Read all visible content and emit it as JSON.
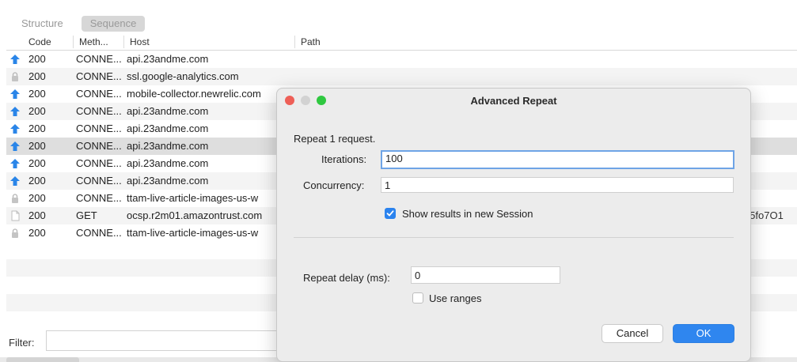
{
  "tabs": {
    "structure": "Structure",
    "sequence": "Sequence"
  },
  "table": {
    "headers": {
      "code": "Code",
      "method": "Meth...",
      "host": "Host",
      "path": "Path"
    },
    "rows": [
      {
        "code": "200",
        "method": "CONNE...",
        "host": "api.23andme.com",
        "path": "",
        "icon": "upload-arrow-icon"
      },
      {
        "code": "200",
        "method": "CONNE...",
        "host": "ssl.google-analytics.com",
        "path": "",
        "icon": "lock-icon"
      },
      {
        "code": "200",
        "method": "CONNE...",
        "host": "mobile-collector.newrelic.com",
        "path": "",
        "icon": "upload-arrow-icon"
      },
      {
        "code": "200",
        "method": "CONNE...",
        "host": "api.23andme.com",
        "path": "",
        "icon": "upload-arrow-icon"
      },
      {
        "code": "200",
        "method": "CONNE...",
        "host": "api.23andme.com",
        "path": "",
        "icon": "upload-arrow-icon"
      },
      {
        "code": "200",
        "method": "CONNE...",
        "host": "api.23andme.com",
        "path": "",
        "icon": "upload-arrow-icon"
      },
      {
        "code": "200",
        "method": "CONNE...",
        "host": "api.23andme.com",
        "path": "",
        "icon": "upload-arrow-icon"
      },
      {
        "code": "200",
        "method": "CONNE...",
        "host": "api.23andme.com",
        "path": "",
        "icon": "upload-arrow-icon"
      },
      {
        "code": "200",
        "method": "CONNE...",
        "host": "ttam-live-article-images-us-w",
        "path": "",
        "icon": "lock-icon"
      },
      {
        "code": "200",
        "method": "GET",
        "host": "ocsp.r2m01.amazontrust.com",
        "path": ":lY5fo7O1",
        "icon": "document-icon"
      },
      {
        "code": "200",
        "method": "CONNE...",
        "host": "ttam-live-article-images-us-w",
        "path": "",
        "icon": "lock-icon"
      }
    ]
  },
  "filter": {
    "label": "Filter:",
    "value": ""
  },
  "dialog": {
    "title": "Advanced Repeat",
    "subtitle": "Repeat 1 request.",
    "iterations_label": "Iterations:",
    "iterations_value": "100",
    "concurrency_label": "Concurrency:",
    "concurrency_value": "1",
    "show_results_label": "Show results in new Session",
    "show_results_checked": true,
    "repeat_delay_label": "Repeat delay (ms):",
    "repeat_delay_value": "0",
    "use_ranges_label": "Use ranges",
    "use_ranges_checked": false,
    "cancel_label": "Cancel",
    "ok_label": "OK"
  },
  "colors": {
    "accent": "#2f86ef",
    "arrow": "#2a85e8",
    "close": "#ee5f57",
    "minimize_inactive": "#d2d2d2",
    "zoom": "#2fc840"
  }
}
